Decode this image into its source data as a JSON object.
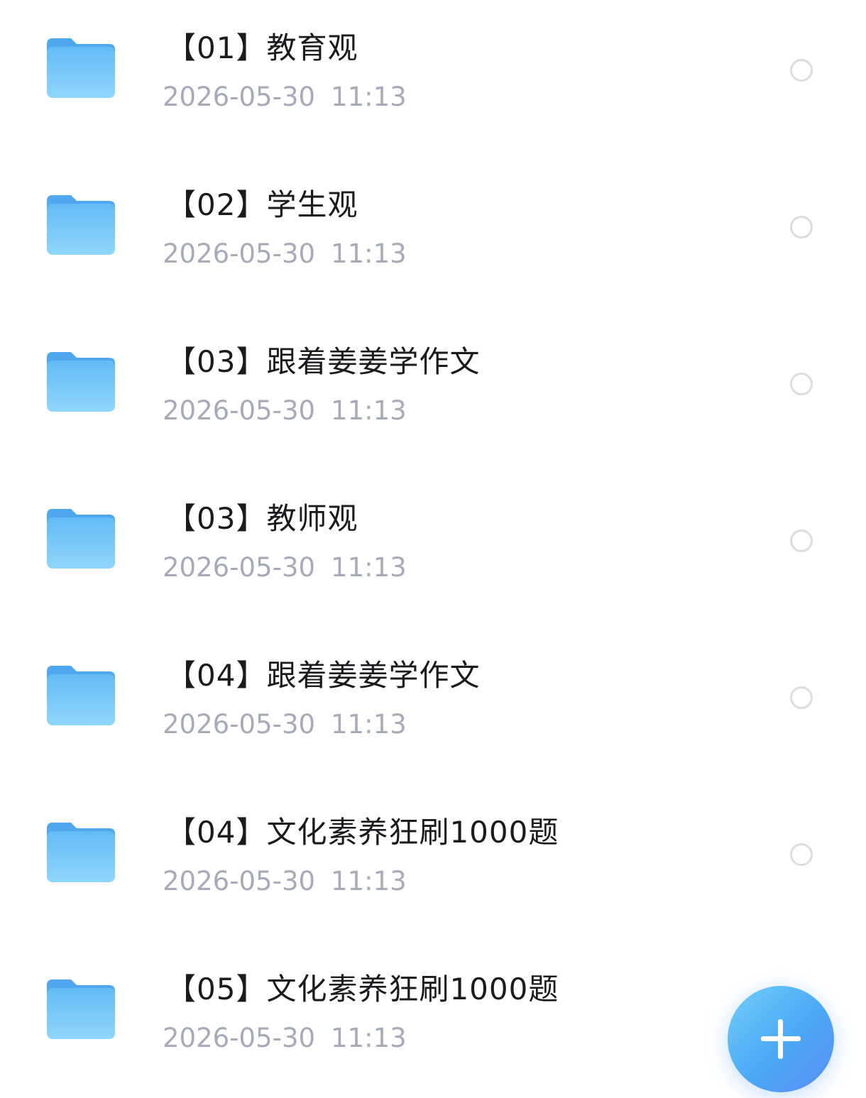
{
  "colors": {
    "folder_back": "#4fa7ee",
    "folder_front_top": "#63bbf6",
    "folder_front_bottom": "#8fd6fb",
    "title_text": "#1b1b1f",
    "meta_text": "#a7aab8",
    "fab_gradient_start": "#73cef9",
    "fab_gradient_end": "#5a8cf5"
  },
  "file_list": {
    "items": [
      {
        "icon": "folder-icon",
        "title": "【01】教育观",
        "date": "2026-05-30",
        "time": "11:13",
        "selected": false
      },
      {
        "icon": "folder-icon",
        "title": "【02】学生观",
        "date": "2026-05-30",
        "time": "11:13",
        "selected": false
      },
      {
        "icon": "folder-icon",
        "title": "【03】跟着姜姜学作文",
        "date": "2026-05-30",
        "time": "11:13",
        "selected": false
      },
      {
        "icon": "folder-icon",
        "title": "【03】教师观",
        "date": "2026-05-30",
        "time": "11:13",
        "selected": false
      },
      {
        "icon": "folder-icon",
        "title": "【04】跟着姜姜学作文",
        "date": "2026-05-30",
        "time": "11:13",
        "selected": false
      },
      {
        "icon": "folder-icon",
        "title": "【04】文化素养狂刷1000题",
        "date": "2026-05-30",
        "time": "11:13",
        "selected": false
      },
      {
        "icon": "folder-icon",
        "title": "【05】文化素养狂刷1000题",
        "date": "2026-05-30",
        "time": "11:13",
        "selected": false
      }
    ]
  },
  "fab": {
    "icon": "plus-icon"
  }
}
